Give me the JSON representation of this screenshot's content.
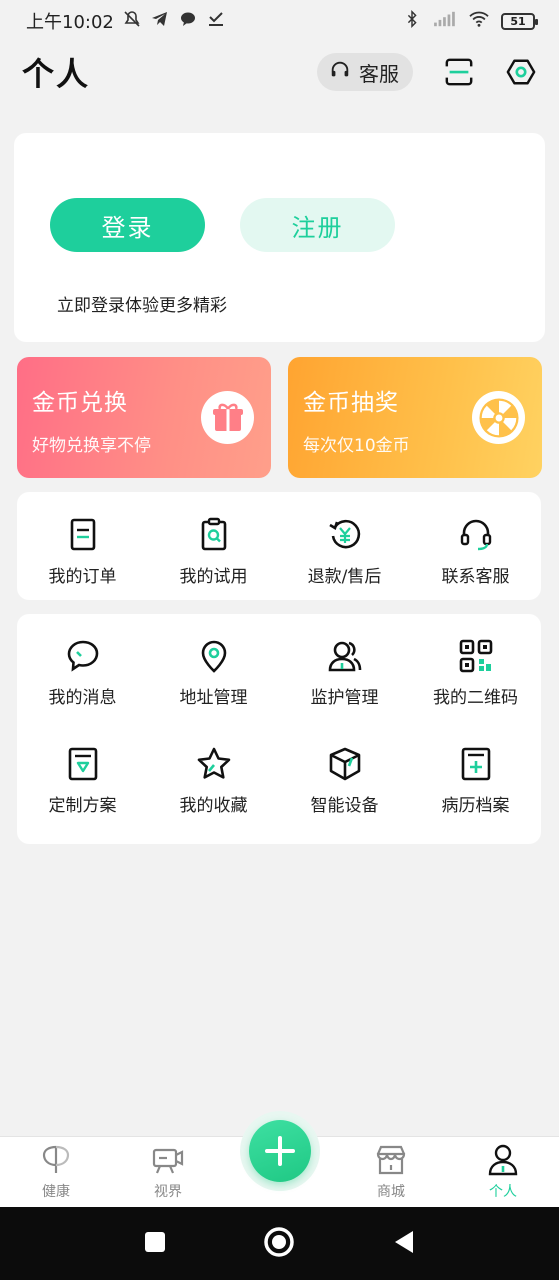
{
  "status_bar": {
    "time": "上午10:02",
    "battery": "51"
  },
  "header": {
    "title": "个人",
    "customer_service": "客服"
  },
  "login_card": {
    "login_label": "登录",
    "register_label": "注册",
    "hint": "立即登录体验更多精彩"
  },
  "promos": [
    {
      "title": "金币兑换",
      "subtitle": "好物兑换享不停",
      "icon": "gift-icon"
    },
    {
      "title": "金币抽奖",
      "subtitle": "每次仅10金币",
      "icon": "lottery-wheel-icon"
    }
  ],
  "orders": [
    {
      "label": "我的订单",
      "icon": "order-icon"
    },
    {
      "label": "我的试用",
      "icon": "trial-icon"
    },
    {
      "label": "退款/售后",
      "icon": "refund-icon"
    },
    {
      "label": "联系客服",
      "icon": "headset-icon"
    }
  ],
  "services": [
    {
      "label": "我的消息",
      "icon": "message-icon"
    },
    {
      "label": "地址管理",
      "icon": "location-icon"
    },
    {
      "label": "监护管理",
      "icon": "guardian-icon"
    },
    {
      "label": "我的二维码",
      "icon": "qrcode-icon"
    },
    {
      "label": "定制方案",
      "icon": "plan-icon"
    },
    {
      "label": "我的收藏",
      "icon": "star-icon"
    },
    {
      "label": "智能设备",
      "icon": "device-icon"
    },
    {
      "label": "病历档案",
      "icon": "medical-record-icon"
    }
  ],
  "tabbar": [
    {
      "label": "健康",
      "icon": "leaf-icon"
    },
    {
      "label": "视界",
      "icon": "video-icon"
    },
    {
      "label": "商城",
      "icon": "store-icon"
    },
    {
      "label": "个人",
      "icon": "person-icon",
      "active": true
    }
  ],
  "colors": {
    "accent": "#1ecf9c",
    "exchange": "#ff7a86",
    "lottery": "#ffb23c"
  }
}
